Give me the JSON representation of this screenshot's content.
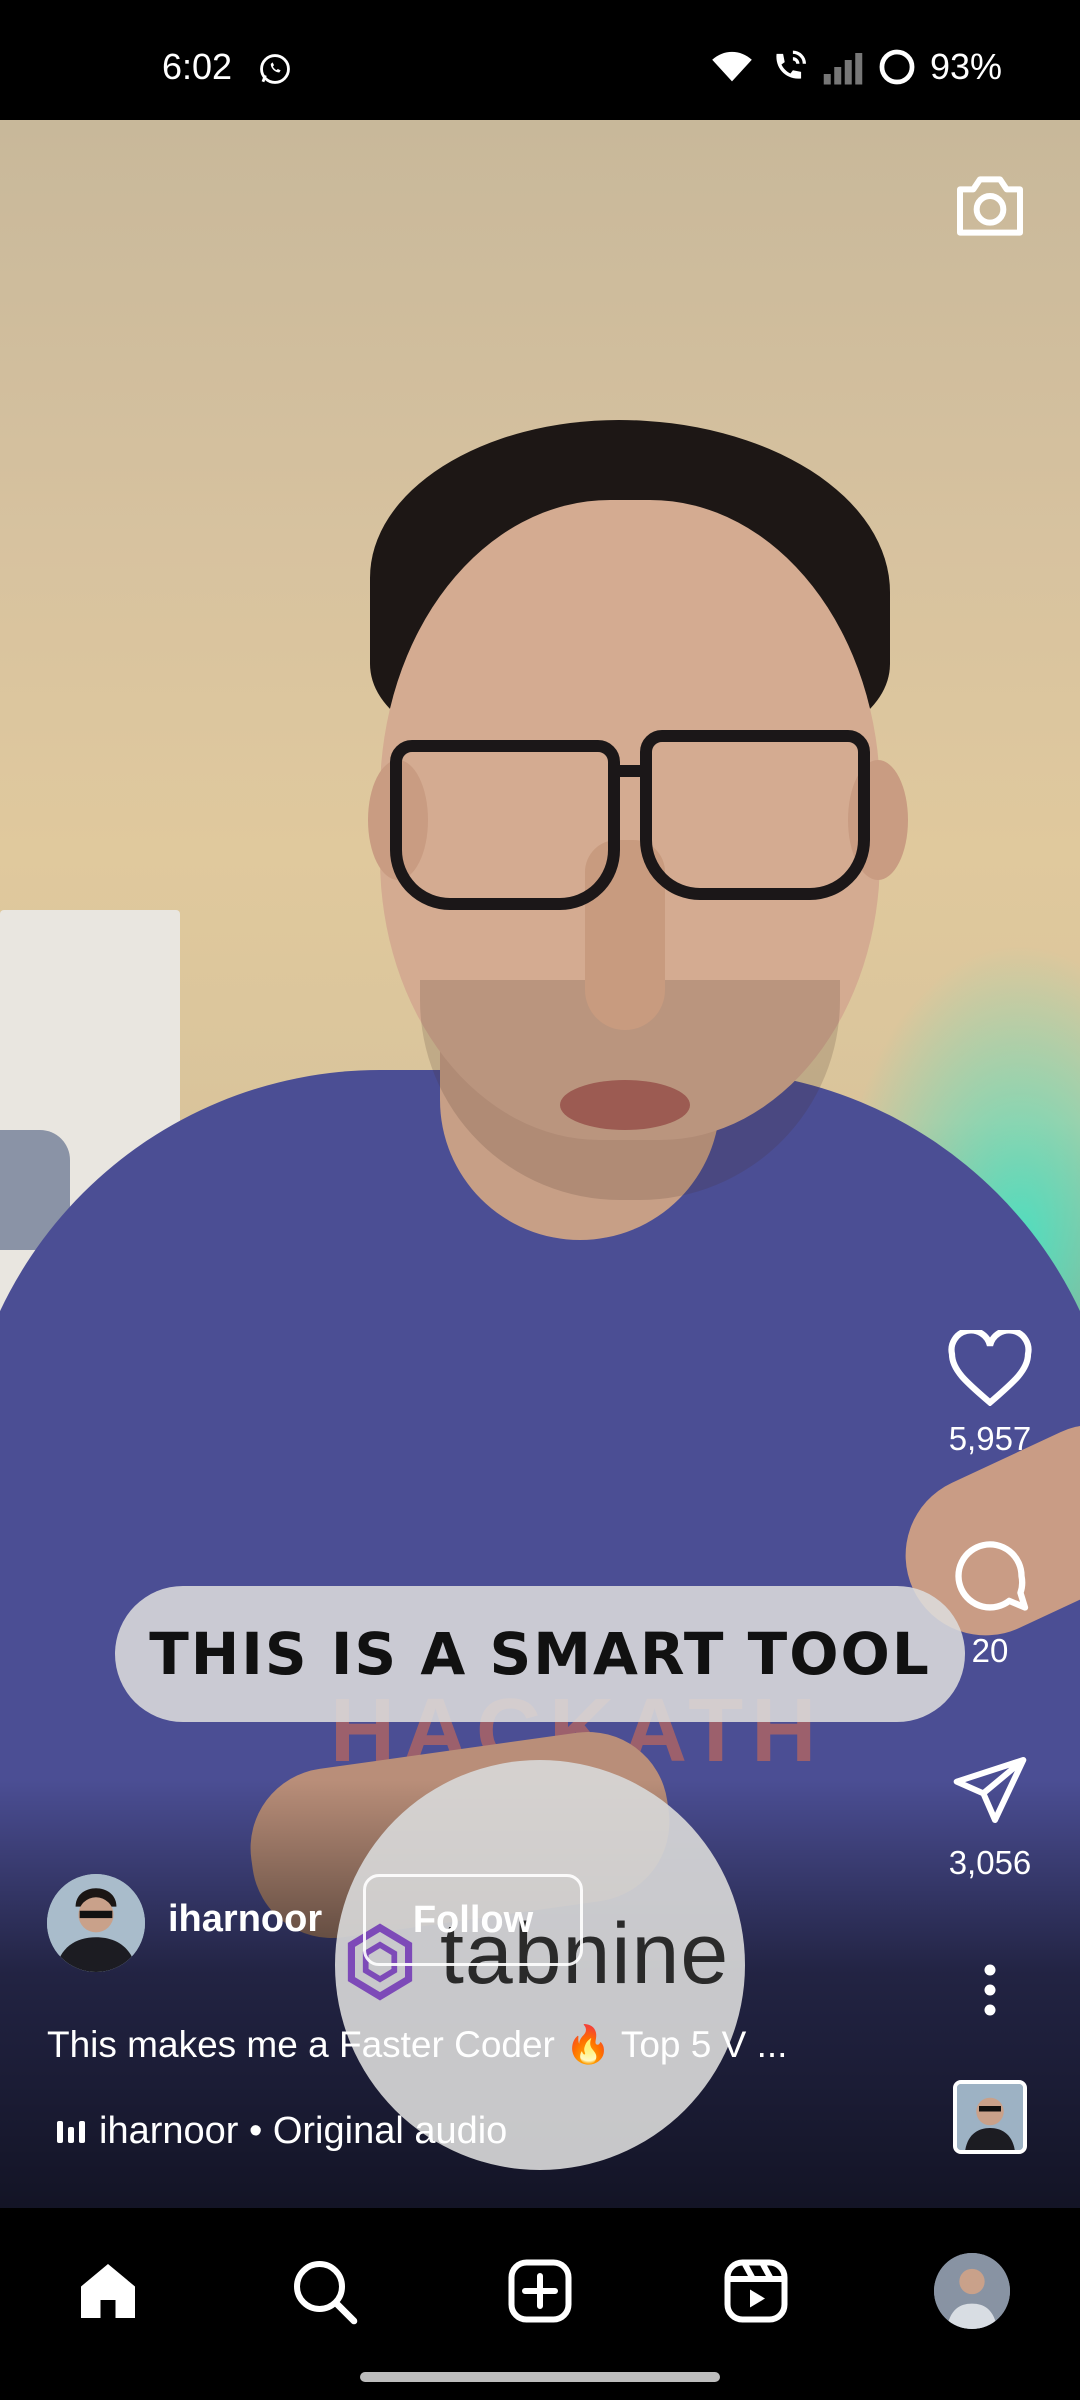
{
  "status_bar": {
    "time": "6:02",
    "battery": "93%",
    "icons": [
      "whatsapp-icon",
      "wifi-icon",
      "wifi-call-icon",
      "signal-icon",
      "battery-icon"
    ]
  },
  "video": {
    "caption_overlay": "THIS IS A SMART TOOL",
    "promo_overlay_text": "tabnine",
    "shirt_print": "HACKATH"
  },
  "actions": {
    "likes": "5,957",
    "comments": "20",
    "shares": "3,056"
  },
  "post": {
    "username": "iharnoor",
    "follow_label": "Follow",
    "description": "This makes me a Faster Coder 🔥 Top 5 V ...",
    "audio": "iharnoor • Original audio"
  },
  "nav": {
    "items": [
      "home-icon",
      "search-icon",
      "create-icon",
      "reels-icon",
      "profile-avatar"
    ]
  },
  "colors": {
    "background": "#000000",
    "accent_overlay": "#DADADA",
    "text": "#FFFFFF"
  }
}
